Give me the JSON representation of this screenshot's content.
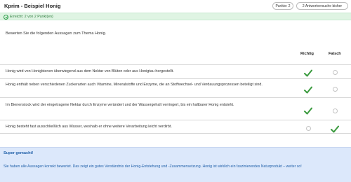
{
  "header": {
    "title": "Kprim - Beispiel Honig",
    "points_label": "Punkte: 2",
    "attempts_label": "2 Antwortversuche bisher"
  },
  "status": {
    "text": "Erreicht: 2 von 2 Punkt(en)",
    "color": "#2e9e4a"
  },
  "question": "Bewerten Sie die folgenden Aussagen zum Thema Honig.",
  "columns": {
    "richtig": "Richtig",
    "falsch": "Falsch"
  },
  "statements": [
    {
      "text": "Honig wird von Honigbienen überwiegend aus dem Nektar von Blüten oder aus Honigtau hergestellt.",
      "selected": "richtig"
    },
    {
      "text": "Honig enthält neben verschiedenen Zuckerarten auch Vitamine, Mineralstoffe und Enzyme, die an Stoffwechsel- und Verdauungsprozessen beteiligt sind.",
      "selected": "richtig"
    },
    {
      "text": "Im Bienenstock wird der eingetragene Nektar durch Enzyme verändert und der Wassergehalt verringert, bis ein haltbarer Honig entsteht.",
      "selected": "richtig"
    },
    {
      "text": "Honig besteht fast ausschließlich aus Wasser, weshalb er ohne weitere Verarbeitung leicht verdirbt.",
      "selected": "falsch"
    }
  ],
  "feedback": {
    "title": "Super gemacht!",
    "text": "Sie haben alle Aussagen korrekt bewertet. Das zeigt ein gutes Verständnis der Honig-Entstehung und -Zusammensetzung. Honig ist wirklich ein faszinierendes Naturprodukt – weiter so!"
  },
  "colors": {
    "check": "#3a9a3e",
    "feedback_bg": "#dce8fb",
    "feedback_text": "#1f5fa8",
    "status_bg": "#dff4e3"
  }
}
